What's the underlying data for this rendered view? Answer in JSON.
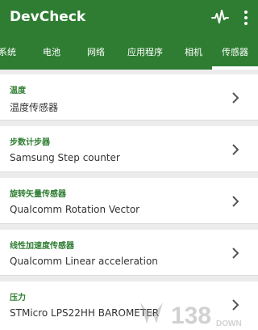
{
  "app": {
    "title": "DevCheck"
  },
  "icons": {
    "activity": "pulse-icon",
    "menu": "more-vertical-icon",
    "chevron": "chevron-right-icon"
  },
  "tabs": [
    {
      "label": "系统"
    },
    {
      "label": "电池"
    },
    {
      "label": "网络"
    },
    {
      "label": "应用程序"
    },
    {
      "label": "相机"
    },
    {
      "label": "传感器",
      "selected": true
    }
  ],
  "sensors": [
    {
      "title": "温度",
      "value": "温度传感器"
    },
    {
      "title": "步数计步器",
      "value": "Samsung Step counter"
    },
    {
      "title": "旋转矢量传感器",
      "value": "Qualcomm Rotation Vector"
    },
    {
      "title": "线性加速度传感器",
      "value": "Qualcomm Linear acceleration"
    },
    {
      "title": "压力",
      "value": "STMicro LPS22HH BAROMETER"
    }
  ],
  "watermark": {
    "text": "138",
    "subtext": "DOWN"
  },
  "colors": {
    "primary": "#2e7d32",
    "background": "#ececec",
    "card": "#ffffff"
  }
}
